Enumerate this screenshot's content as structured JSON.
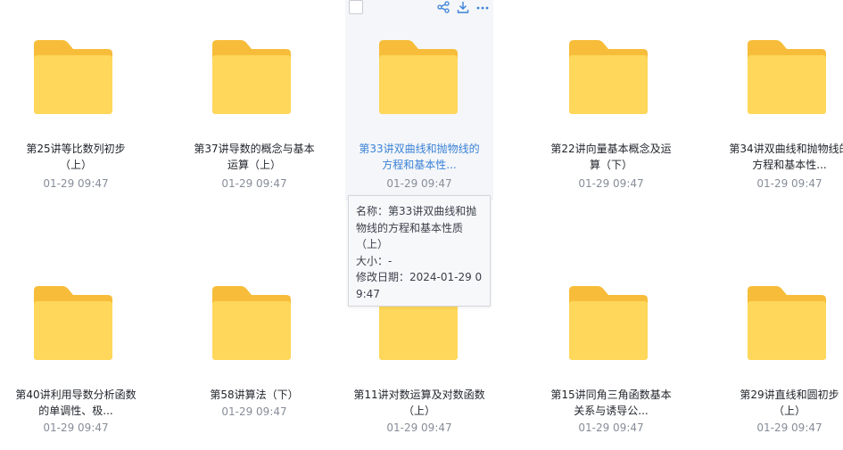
{
  "files": [
    {
      "name_line1": "第25讲等比数列初步",
      "name_line2": "（上）",
      "date": "01-29 09:47"
    },
    {
      "name_line1": "第37讲导数的概念与基本",
      "name_line2": "运算（上）",
      "date": "01-29 09:47"
    },
    {
      "name_line1": "第33讲双曲线和抛物线的",
      "name_line2": "方程和基本性...",
      "date": "01-29 09:47"
    },
    {
      "name_line1": "第22讲向量基本概念及运",
      "name_line2": "算（下）",
      "date": "01-29 09:47"
    },
    {
      "name_line1": "第34讲双曲线和抛物线的",
      "name_line2": "方程和基本性...",
      "date": "01-29 09:47"
    },
    {
      "name_line1": "第40讲利用导数分析函数",
      "name_line2": "的单调性、极...",
      "date": "01-29 09:47"
    },
    {
      "name_line1": "第58讲算法（下）",
      "name_line2": "",
      "date": "01-29 09:47"
    },
    {
      "name_line1": "第11讲对数运算及对数函数",
      "name_line2": "（上）",
      "date": "01-29 09:47"
    },
    {
      "name_line1": "第15讲同角三角函数基本",
      "name_line2": "关系与诱导公...",
      "date": "01-29 09:47"
    },
    {
      "name_line1": "第29讲直线和圆初步",
      "name_line2": "（上）",
      "date": "01-29 09:47"
    }
  ],
  "tooltip": {
    "line1": "名称：第33讲双曲线和抛",
    "line2": "物线的方程和基本性质",
    "line3": "（上）",
    "line4": "大小：-",
    "line5": "修改日期：2024-01-29 0",
    "line6": "9:47"
  },
  "icons": {
    "folder": "folder-icon",
    "share": "share-icon",
    "download": "download-icon",
    "more": "more-icon"
  },
  "colors": {
    "folder_back": "#f7bd3a",
    "folder_front": "#ffd75a",
    "accent": "#3b82d6"
  }
}
